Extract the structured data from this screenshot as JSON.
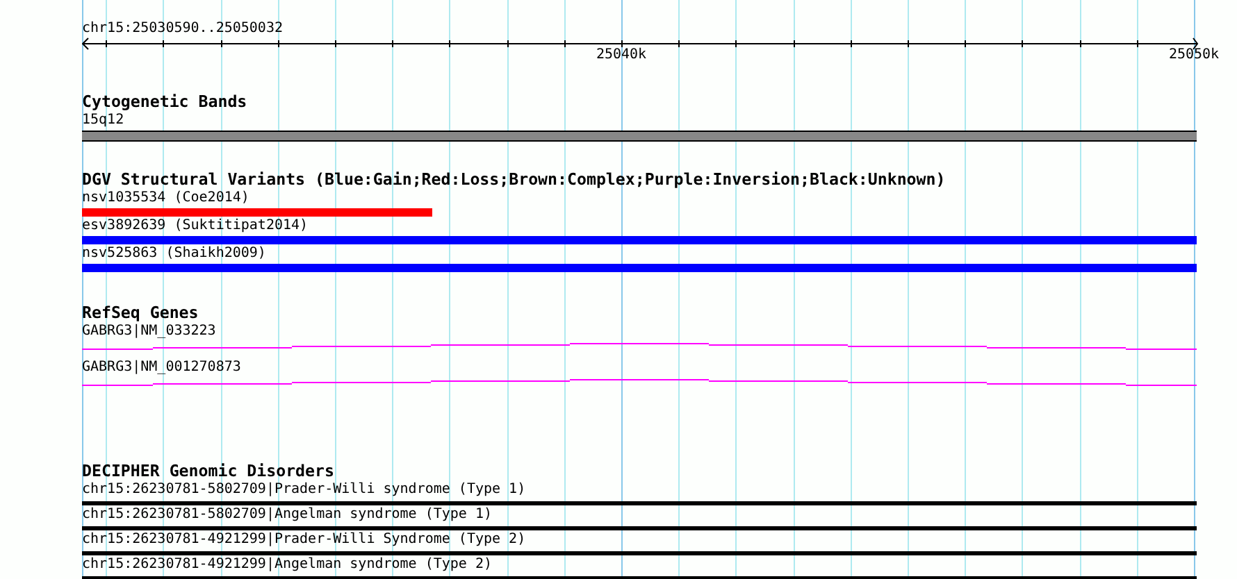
{
  "ruler": {
    "region": "chr15:25030590..25050032",
    "tick_labels": [
      "25040k",
      "25050k"
    ]
  },
  "tracks": [
    {
      "kind": "cytoband",
      "title": "Cytogenetic Bands",
      "features": [
        {
          "label": "15q12"
        }
      ]
    },
    {
      "kind": "variants",
      "title": "DGV Structural Variants (Blue:Gain;Red:Loss;Brown:Complex;Purple:Inversion;Black:Unknown)",
      "features": [
        {
          "label": "nsv1035534 (Coe2014)",
          "color": "#ff0000",
          "level": 0.314
        },
        {
          "label": "esv3892639 (Suktitipat2014)",
          "color": "#0000ff",
          "level": 1
        },
        {
          "label": "nsv525863 (Shaikh2009)",
          "color": "#0000ff",
          "level": 1
        }
      ]
    },
    {
      "kind": "genes",
      "title": "RefSeq Genes",
      "features": [
        {
          "label": "GABRG3|NM_033223"
        },
        {
          "label": "GABRG3|NM_001270873"
        }
      ]
    },
    {
      "kind": "disorders",
      "title": "DECIPHER Genomic Disorders",
      "features": [
        {
          "label": "chr15:26230781-5802709|Prader-Willi syndrome (Type 1)"
        },
        {
          "label": "chr15:26230781-5802709|Angelman syndrome (Type 1)"
        },
        {
          "label": "chr15:26230781-4921299|Prader-Willi Syndrome (Type 2)"
        },
        {
          "label": "chr15:26230781-4921299|Angelman syndrome (Type 2)"
        }
      ]
    }
  ]
}
